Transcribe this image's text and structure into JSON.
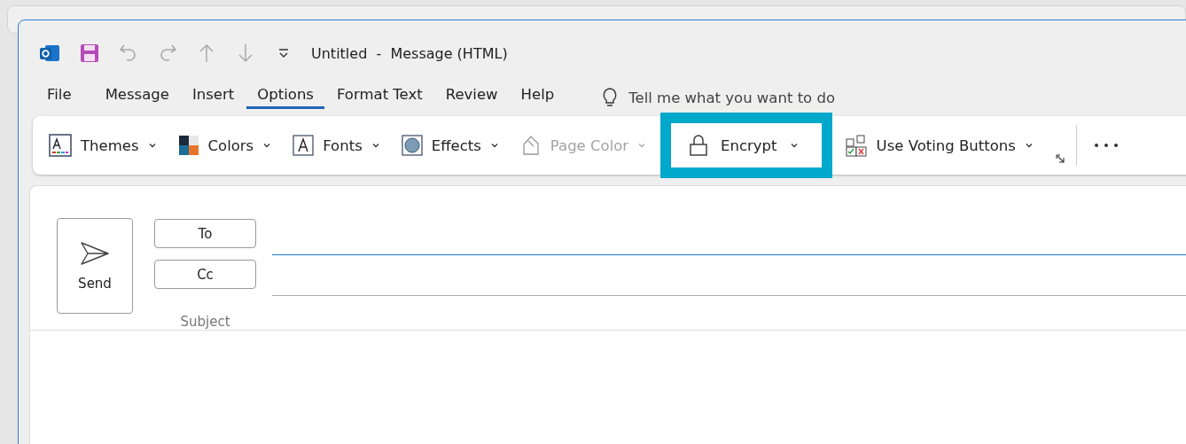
{
  "window": {
    "title": "Untitled  -  Message (HTML)"
  },
  "quick_access": [
    {
      "kind": "save",
      "disabled": false
    },
    {
      "kind": "undo",
      "disabled": true
    },
    {
      "kind": "redo",
      "disabled": true
    },
    {
      "kind": "up",
      "disabled": true
    },
    {
      "kind": "down",
      "disabled": true
    },
    {
      "kind": "customize",
      "disabled": false
    }
  ],
  "tabs": [
    {
      "label": "File",
      "selected": false
    },
    {
      "label": "Message",
      "selected": false
    },
    {
      "label": "Insert",
      "selected": false
    },
    {
      "label": "Options",
      "selected": true
    },
    {
      "label": "Format Text",
      "selected": false
    },
    {
      "label": "Review",
      "selected": false
    },
    {
      "label": "Help",
      "selected": false
    }
  ],
  "tell_me": {
    "placeholder": "Tell me what you want to do"
  },
  "ribbon": [
    {
      "kind": "themes",
      "label": "Themes",
      "disabled": false,
      "highlighted": false
    },
    {
      "kind": "colors",
      "label": "Colors",
      "disabled": false,
      "highlighted": false
    },
    {
      "kind": "fonts",
      "label": "Fonts",
      "disabled": false,
      "highlighted": false
    },
    {
      "kind": "effects",
      "label": "Effects",
      "disabled": false,
      "highlighted": false
    },
    {
      "kind": "page-color",
      "label": "Page Color",
      "disabled": true,
      "highlighted": false
    },
    {
      "kind": "encrypt",
      "label": "Encrypt",
      "disabled": false,
      "highlighted": true
    },
    {
      "kind": "voting",
      "label": "Use Voting Buttons",
      "disabled": false,
      "highlighted": false
    }
  ],
  "compose": {
    "send": "Send",
    "to": "To",
    "cc": "Cc",
    "subject": "Subject"
  }
}
